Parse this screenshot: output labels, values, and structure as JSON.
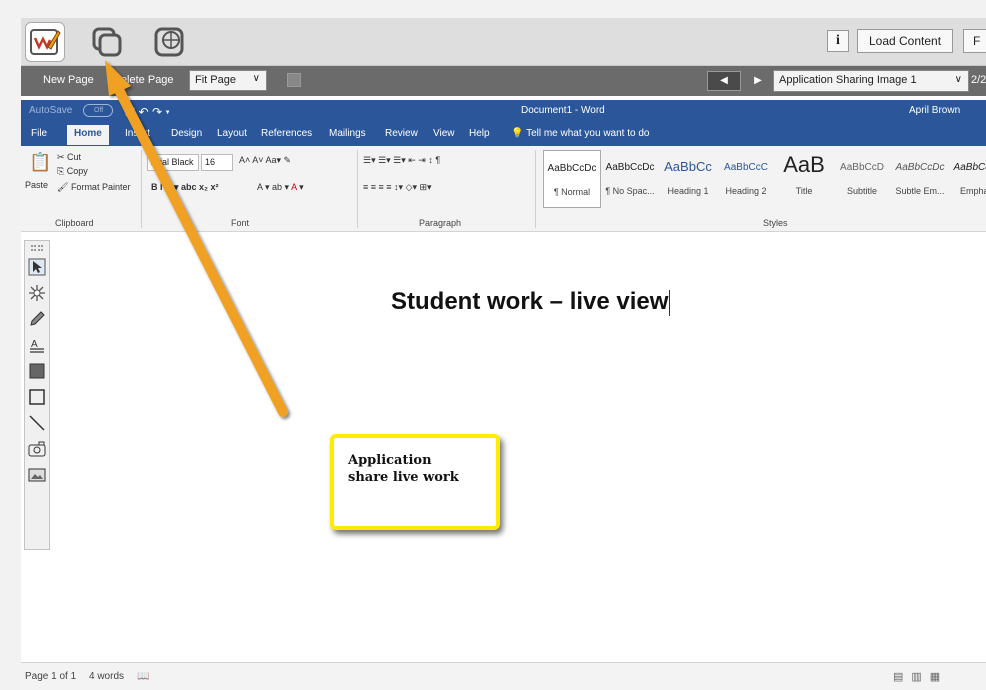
{
  "app_toolbar": {
    "tools": [
      {
        "name": "annotate-tool",
        "active": true
      },
      {
        "name": "application-share-tool",
        "active": false
      },
      {
        "name": "web-share-tool",
        "active": false
      }
    ],
    "info_label": "i",
    "load_content_label": "Load Content",
    "cut_label": "F"
  },
  "page_toolbar": {
    "new_page_label": "New Page",
    "delete_page_label": "Delete Page",
    "fit_select": {
      "value": "Fit Page"
    },
    "image_select": {
      "value": "Application Sharing Image 1"
    },
    "page_count": "2/2"
  },
  "word": {
    "autosave_label": "AutoSave",
    "autosave_state": "Off",
    "doc_title": "Document1 - Word",
    "user_name": "April Brown",
    "tabs": [
      "File",
      "Home",
      "Insert",
      "Design",
      "Layout",
      "References",
      "Mailings",
      "Review",
      "View",
      "Help"
    ],
    "tell_me": "Tell me what you want to do",
    "clipboard": {
      "paste": "Paste",
      "cut": "Cut",
      "copy": "Copy",
      "format_painter": "Format Painter",
      "group": "Clipboard"
    },
    "font": {
      "name": "Arial Black",
      "size": "16",
      "group": "Font"
    },
    "paragraph": {
      "group": "Paragraph"
    },
    "styles": {
      "group": "Styles",
      "items": [
        {
          "sample": "AaBbCcDc",
          "name": "¶ Normal"
        },
        {
          "sample": "AaBbCcDc",
          "name": "¶ No Spac..."
        },
        {
          "sample": "AaBbCc",
          "name": "Heading 1"
        },
        {
          "sample": "AaBbCcC",
          "name": "Heading 2"
        },
        {
          "sample": "AaB",
          "name": "Title"
        },
        {
          "sample": "AaBbCcD",
          "name": "Subtitle"
        },
        {
          "sample": "AaBbCcDc",
          "name": "Subtle Em..."
        },
        {
          "sample": "AaBbCcDc",
          "name": "Empha..."
        }
      ]
    }
  },
  "document": {
    "heading": "Student work – live view"
  },
  "callout": {
    "text_line1": "Application",
    "text_line2": "share live work"
  },
  "status": {
    "page": "Page 1 of 1",
    "words": "4 words"
  },
  "colors": {
    "word_blue": "#2b579a",
    "callout_border": "#ffeb00",
    "arrow": "#f39c12"
  }
}
